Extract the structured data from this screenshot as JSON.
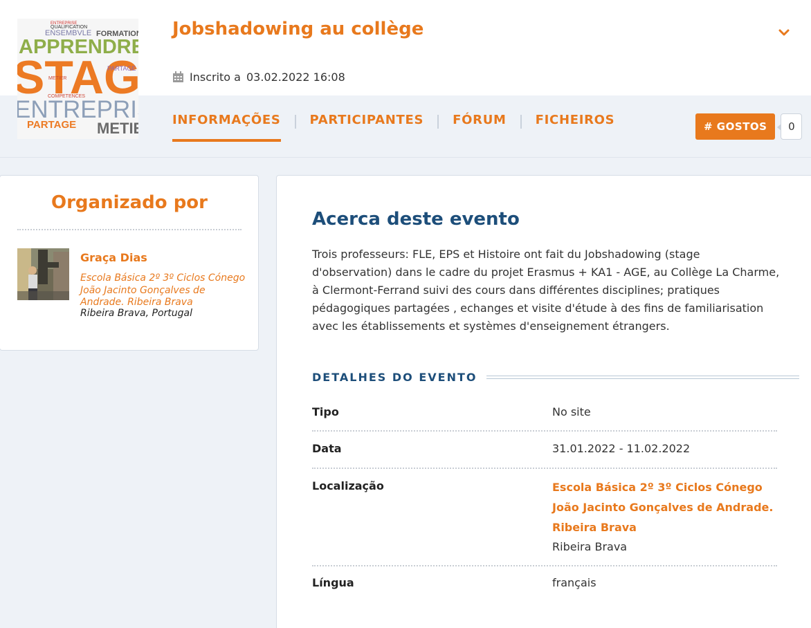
{
  "event": {
    "title": "Jobshadowing au collège",
    "subscribed_label": "Inscrito a",
    "subscribed_date": "03.02.2022 16:08",
    "thumbnail_words": [
      "ENTREPRISE",
      "QUALIFICATION",
      "ENSEMBVLE",
      "FORMATION",
      "APPRENDRE",
      "STAGE",
      "PARTAGE",
      "METIER",
      "COMPETENCES",
      "ENTREPRISE",
      "PARTAGE",
      "METIER"
    ]
  },
  "tabs": [
    {
      "label": "INFORMAÇÕES",
      "active": true
    },
    {
      "label": "PARTICIPANTES",
      "active": false
    },
    {
      "label": "FÓRUM",
      "active": false
    },
    {
      "label": "FICHEIROS",
      "active": false
    }
  ],
  "likes": {
    "label": "# GOSTOS",
    "count": "0"
  },
  "organizer": {
    "heading": "Organizado por",
    "name": "Graça Dias",
    "school": "Escola Básica 2º 3º Ciclos Cónego João Jacinto Gonçalves de Andrade. Ribeira Brava",
    "location": "Ribeira Brava, Portugal"
  },
  "about": {
    "heading": "Acerca deste evento",
    "text": "Trois professeurs: FLE, EPS et Histoire ont fait du Jobshadowing (stage d'observation) dans le cadre du projet Erasmus + KA1 - AGE, au Collège La Charme, à Clermont-Ferrand suivi des cours dans différentes disciplines; pratiques pédagogiques partagées , echanges et visite d'étude à des fins de familiarisation avec les établissements et systèmes d'enseignement étrangers."
  },
  "details": {
    "heading": "DETALHES DO EVENTO",
    "tipo_label": "Tipo",
    "tipo_value": "No site",
    "data_label": "Data",
    "data_value": "31.01.2022 - 11.02.2022",
    "local_label": "Localização",
    "local_school": "Escola Básica 2º 3º Ciclos Cónego João Jacinto Gonçalves de Andrade. Ribeira Brava",
    "local_city": "Ribeira Brava",
    "lingua_label": "Língua",
    "lingua_value": "français"
  },
  "colors": {
    "accent": "#e8791d",
    "heading_blue": "#1d4e7a",
    "background": "#eef2f7"
  },
  "icons": [
    "chevron-down-icon",
    "calendar-icon"
  ]
}
